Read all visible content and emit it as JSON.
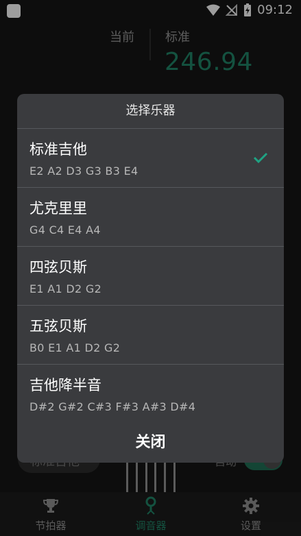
{
  "status": {
    "time": "09:12"
  },
  "tuner": {
    "current_label": "当前",
    "standard_label": "标准",
    "frequency": "246.94",
    "accent_color": "#1f7f63"
  },
  "background": {
    "instrument_label": "标准吉他",
    "auto_label": "自动"
  },
  "dialog": {
    "title": "选择乐器",
    "items": [
      {
        "name": "标准吉他",
        "notes": "E2  A2  D3  G3  B3  E4",
        "selected": true
      },
      {
        "name": "尤克里里",
        "notes": "G4  C4  E4  A4",
        "selected": false
      },
      {
        "name": "四弦贝斯",
        "notes": "E1 A1 D2 G2",
        "selected": false
      },
      {
        "name": "五弦贝斯",
        "notes": "B0  E1  A1  D2  G2",
        "selected": false
      },
      {
        "name": "吉他降半音",
        "notes": "D#2  G#2  C#3  F#3  A#3  D#4",
        "selected": false
      }
    ],
    "close_label": "关闭"
  },
  "nav": {
    "items": [
      {
        "label": "节拍器",
        "icon": "trophy-icon",
        "active": false
      },
      {
        "label": "调音器",
        "icon": "tuner-pin-icon",
        "active": true
      },
      {
        "label": "设置",
        "icon": "gear-icon",
        "active": false
      }
    ]
  }
}
